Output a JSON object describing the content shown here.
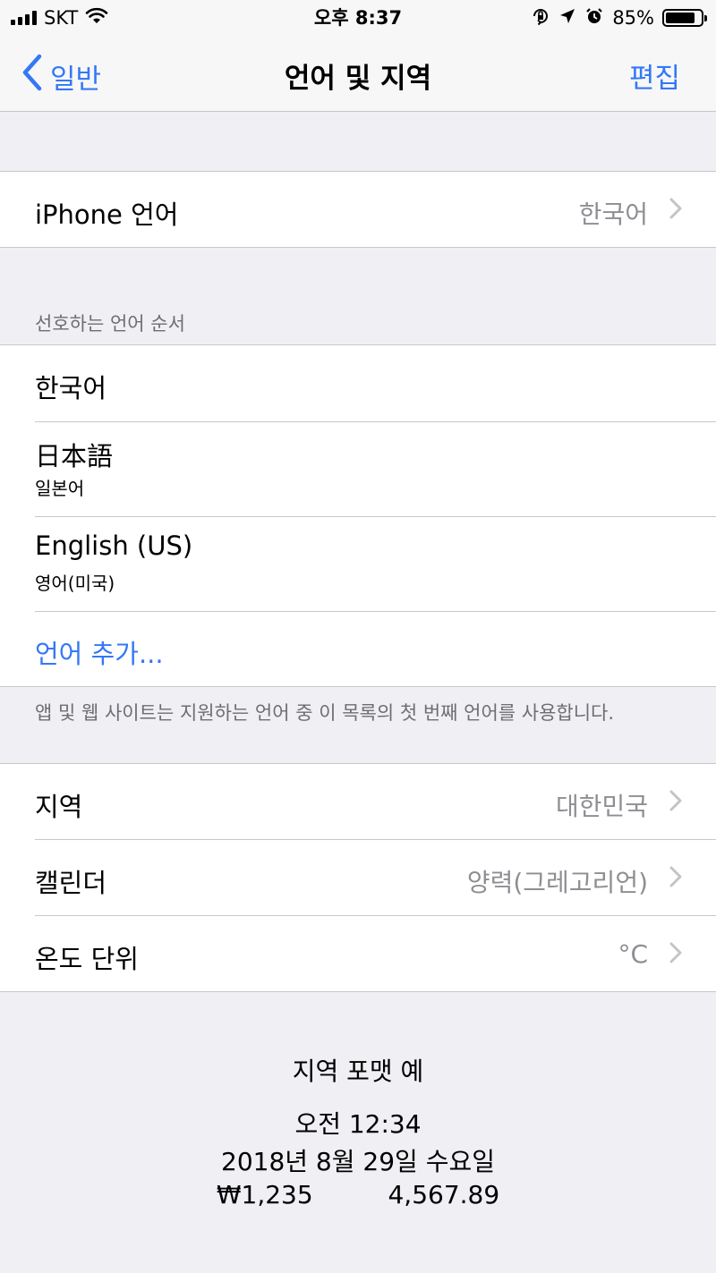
{
  "status_bar": {
    "carrier": "SKT",
    "time": "오후 8:37",
    "battery_percent": "85%",
    "battery_level": 0.85,
    "icons": [
      "signal-bars-icon",
      "wifi-icon",
      "orientation-lock-icon",
      "location-arrow-icon",
      "alarm-icon",
      "battery-icon"
    ]
  },
  "nav": {
    "back_label": "일반",
    "title": "언어 및 지역",
    "edit_label": "편집"
  },
  "iphone_language": {
    "label": "iPhone 언어",
    "value": "한국어"
  },
  "preferred": {
    "header": "선호하는 언어 순서",
    "languages": [
      {
        "name": "한국어",
        "sub": ""
      },
      {
        "name": "日本語",
        "sub": "일본어"
      },
      {
        "name": "English (US)",
        "sub": "영어(미국)"
      }
    ],
    "add_label": "언어 추가...",
    "footer": "앱 및 웹 사이트는 지원하는 언어 중 이 목록의 첫 번째 언어를 사용합니다."
  },
  "region_settings": [
    {
      "label": "지역",
      "value": "대한민국"
    },
    {
      "label": "캘린더",
      "value": "양력(그레고리언)"
    },
    {
      "label": "온도 단위",
      "value": "°C"
    }
  ],
  "format_example": {
    "title": "지역 포맷 예",
    "time": "오전 12:34",
    "date": "2018년 8월 29일 수요일",
    "currency": "₩1,235",
    "number": "4,567.89"
  },
  "colors": {
    "accent": "#3478f6",
    "background": "#efeff4",
    "secondary_text": "#8e8e93",
    "separator": "#c8c7cc"
  }
}
